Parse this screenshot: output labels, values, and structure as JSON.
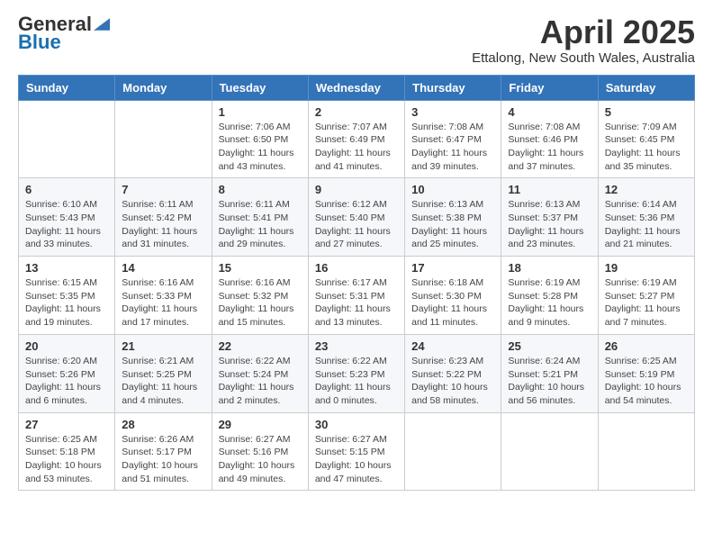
{
  "logo": {
    "general": "General",
    "blue": "Blue"
  },
  "title": "April 2025",
  "subtitle": "Ettalong, New South Wales, Australia",
  "days_of_week": [
    "Sunday",
    "Monday",
    "Tuesday",
    "Wednesday",
    "Thursday",
    "Friday",
    "Saturday"
  ],
  "weeks": [
    [
      {
        "day": null
      },
      {
        "day": null
      },
      {
        "day": "1",
        "sunrise": "Sunrise: 7:06 AM",
        "sunset": "Sunset: 6:50 PM",
        "daylight": "Daylight: 11 hours and 43 minutes."
      },
      {
        "day": "2",
        "sunrise": "Sunrise: 7:07 AM",
        "sunset": "Sunset: 6:49 PM",
        "daylight": "Daylight: 11 hours and 41 minutes."
      },
      {
        "day": "3",
        "sunrise": "Sunrise: 7:08 AM",
        "sunset": "Sunset: 6:47 PM",
        "daylight": "Daylight: 11 hours and 39 minutes."
      },
      {
        "day": "4",
        "sunrise": "Sunrise: 7:08 AM",
        "sunset": "Sunset: 6:46 PM",
        "daylight": "Daylight: 11 hours and 37 minutes."
      },
      {
        "day": "5",
        "sunrise": "Sunrise: 7:09 AM",
        "sunset": "Sunset: 6:45 PM",
        "daylight": "Daylight: 11 hours and 35 minutes."
      }
    ],
    [
      {
        "day": "6",
        "sunrise": "Sunrise: 6:10 AM",
        "sunset": "Sunset: 5:43 PM",
        "daylight": "Daylight: 11 hours and 33 minutes."
      },
      {
        "day": "7",
        "sunrise": "Sunrise: 6:11 AM",
        "sunset": "Sunset: 5:42 PM",
        "daylight": "Daylight: 11 hours and 31 minutes."
      },
      {
        "day": "8",
        "sunrise": "Sunrise: 6:11 AM",
        "sunset": "Sunset: 5:41 PM",
        "daylight": "Daylight: 11 hours and 29 minutes."
      },
      {
        "day": "9",
        "sunrise": "Sunrise: 6:12 AM",
        "sunset": "Sunset: 5:40 PM",
        "daylight": "Daylight: 11 hours and 27 minutes."
      },
      {
        "day": "10",
        "sunrise": "Sunrise: 6:13 AM",
        "sunset": "Sunset: 5:38 PM",
        "daylight": "Daylight: 11 hours and 25 minutes."
      },
      {
        "day": "11",
        "sunrise": "Sunrise: 6:13 AM",
        "sunset": "Sunset: 5:37 PM",
        "daylight": "Daylight: 11 hours and 23 minutes."
      },
      {
        "day": "12",
        "sunrise": "Sunrise: 6:14 AM",
        "sunset": "Sunset: 5:36 PM",
        "daylight": "Daylight: 11 hours and 21 minutes."
      }
    ],
    [
      {
        "day": "13",
        "sunrise": "Sunrise: 6:15 AM",
        "sunset": "Sunset: 5:35 PM",
        "daylight": "Daylight: 11 hours and 19 minutes."
      },
      {
        "day": "14",
        "sunrise": "Sunrise: 6:16 AM",
        "sunset": "Sunset: 5:33 PM",
        "daylight": "Daylight: 11 hours and 17 minutes."
      },
      {
        "day": "15",
        "sunrise": "Sunrise: 6:16 AM",
        "sunset": "Sunset: 5:32 PM",
        "daylight": "Daylight: 11 hours and 15 minutes."
      },
      {
        "day": "16",
        "sunrise": "Sunrise: 6:17 AM",
        "sunset": "Sunset: 5:31 PM",
        "daylight": "Daylight: 11 hours and 13 minutes."
      },
      {
        "day": "17",
        "sunrise": "Sunrise: 6:18 AM",
        "sunset": "Sunset: 5:30 PM",
        "daylight": "Daylight: 11 hours and 11 minutes."
      },
      {
        "day": "18",
        "sunrise": "Sunrise: 6:19 AM",
        "sunset": "Sunset: 5:28 PM",
        "daylight": "Daylight: 11 hours and 9 minutes."
      },
      {
        "day": "19",
        "sunrise": "Sunrise: 6:19 AM",
        "sunset": "Sunset: 5:27 PM",
        "daylight": "Daylight: 11 hours and 7 minutes."
      }
    ],
    [
      {
        "day": "20",
        "sunrise": "Sunrise: 6:20 AM",
        "sunset": "Sunset: 5:26 PM",
        "daylight": "Daylight: 11 hours and 6 minutes."
      },
      {
        "day": "21",
        "sunrise": "Sunrise: 6:21 AM",
        "sunset": "Sunset: 5:25 PM",
        "daylight": "Daylight: 11 hours and 4 minutes."
      },
      {
        "day": "22",
        "sunrise": "Sunrise: 6:22 AM",
        "sunset": "Sunset: 5:24 PM",
        "daylight": "Daylight: 11 hours and 2 minutes."
      },
      {
        "day": "23",
        "sunrise": "Sunrise: 6:22 AM",
        "sunset": "Sunset: 5:23 PM",
        "daylight": "Daylight: 11 hours and 0 minutes."
      },
      {
        "day": "24",
        "sunrise": "Sunrise: 6:23 AM",
        "sunset": "Sunset: 5:22 PM",
        "daylight": "Daylight: 10 hours and 58 minutes."
      },
      {
        "day": "25",
        "sunrise": "Sunrise: 6:24 AM",
        "sunset": "Sunset: 5:21 PM",
        "daylight": "Daylight: 10 hours and 56 minutes."
      },
      {
        "day": "26",
        "sunrise": "Sunrise: 6:25 AM",
        "sunset": "Sunset: 5:19 PM",
        "daylight": "Daylight: 10 hours and 54 minutes."
      }
    ],
    [
      {
        "day": "27",
        "sunrise": "Sunrise: 6:25 AM",
        "sunset": "Sunset: 5:18 PM",
        "daylight": "Daylight: 10 hours and 53 minutes."
      },
      {
        "day": "28",
        "sunrise": "Sunrise: 6:26 AM",
        "sunset": "Sunset: 5:17 PM",
        "daylight": "Daylight: 10 hours and 51 minutes."
      },
      {
        "day": "29",
        "sunrise": "Sunrise: 6:27 AM",
        "sunset": "Sunset: 5:16 PM",
        "daylight": "Daylight: 10 hours and 49 minutes."
      },
      {
        "day": "30",
        "sunrise": "Sunrise: 6:27 AM",
        "sunset": "Sunset: 5:15 PM",
        "daylight": "Daylight: 10 hours and 47 minutes."
      },
      {
        "day": null
      },
      {
        "day": null
      },
      {
        "day": null
      }
    ]
  ]
}
